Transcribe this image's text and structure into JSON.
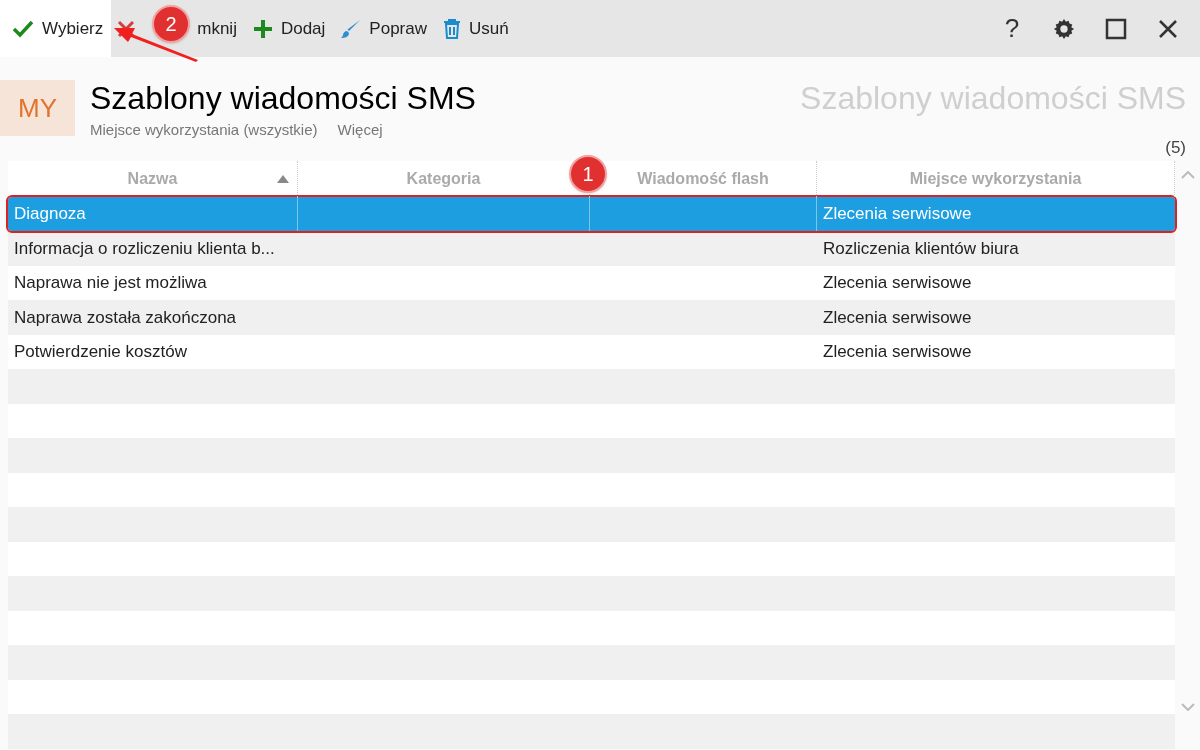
{
  "toolbar": {
    "items": [
      {
        "kind": "check",
        "label": "Wybierz",
        "selected": true
      },
      {
        "kind": "close",
        "label": "mknij",
        "selected": false
      },
      {
        "kind": "add",
        "label": "Dodaj",
        "selected": false
      },
      {
        "kind": "edit",
        "label": "Popraw",
        "selected": false
      },
      {
        "kind": "delete",
        "label": "Usuń",
        "selected": false
      }
    ],
    "right_icons": [
      {
        "kind": "help",
        "label": "?"
      },
      {
        "kind": "settings"
      },
      {
        "kind": "maximize"
      },
      {
        "kind": "close"
      }
    ]
  },
  "header": {
    "badge": "MY",
    "title": "Szablony wiadomości SMS",
    "filter": "Miejsce wykorzystania (wszystkie)",
    "more": "Więcej",
    "watermark_title": "Szablony wiadomości SMS",
    "count": "(5)"
  },
  "table": {
    "columns": [
      {
        "label": "Nazwa",
        "sorted": true
      },
      {
        "label": "Kategoria",
        "sorted": false
      },
      {
        "label": "Wiadomość flash",
        "sorted": false
      },
      {
        "label": "Miejsce wykorzystania",
        "sorted": false
      }
    ],
    "rows": [
      {
        "cells": [
          "Diagnoza",
          "",
          "",
          "Zlecenia serwisowe"
        ],
        "selected": true
      },
      {
        "cells": [
          "Informacja o rozliczeniu klienta b...",
          "",
          "",
          "Rozliczenia klientów biura"
        ],
        "selected": false
      },
      {
        "cells": [
          "Naprawa nie jest możliwa",
          "",
          "",
          "Zlecenia serwisowe"
        ],
        "selected": false
      },
      {
        "cells": [
          "Naprawa została zakończona",
          "",
          "",
          "Zlecenia serwisowe"
        ],
        "selected": false
      },
      {
        "cells": [
          "Potwierdzenie kosztów",
          "",
          "",
          "Zlecenia serwisowe"
        ],
        "selected": false
      }
    ]
  },
  "callouts": [
    {
      "label": "1"
    },
    {
      "label": "2"
    }
  ]
}
